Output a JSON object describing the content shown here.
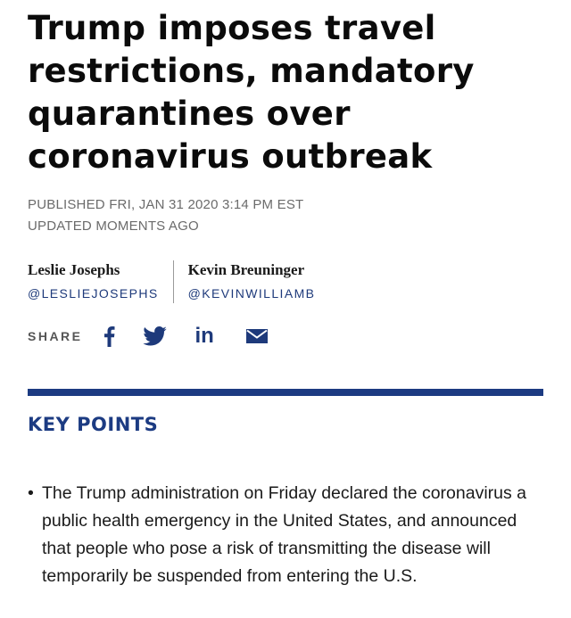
{
  "article": {
    "headline": "Trump imposes travel restrictions, mandatory quarantines over coronavirus outbreak",
    "published": "PUBLISHED FRI, JAN 31 2020 3:14 PM EST",
    "updated": "UPDATED MOMENTS AGO"
  },
  "authors": [
    {
      "name": "Leslie Josephs",
      "handle": "@LESLIEJOSEPHS"
    },
    {
      "name": "Kevin Breuninger",
      "handle": "@KEVINWILLIAMB"
    }
  ],
  "share": {
    "label": "SHARE",
    "icons": [
      "facebook-icon",
      "twitter-icon",
      "linkedin-icon",
      "email-icon"
    ],
    "linkedin_text": "in",
    "accent_color": "#1e3a7b"
  },
  "key_points": {
    "title": "KEY POINTS",
    "bullet": "•",
    "items": [
      "The Trump administration on Friday declared the coronavirus a public health emergency in the United States, and announced that people who pose a risk of transmitting the disease will temporarily be suspended from entering the U.S."
    ]
  },
  "colors": {
    "brand_blue": "#1c3b82",
    "meta_gray": "#6b6b6b",
    "headline": "#0b0b0b"
  }
}
